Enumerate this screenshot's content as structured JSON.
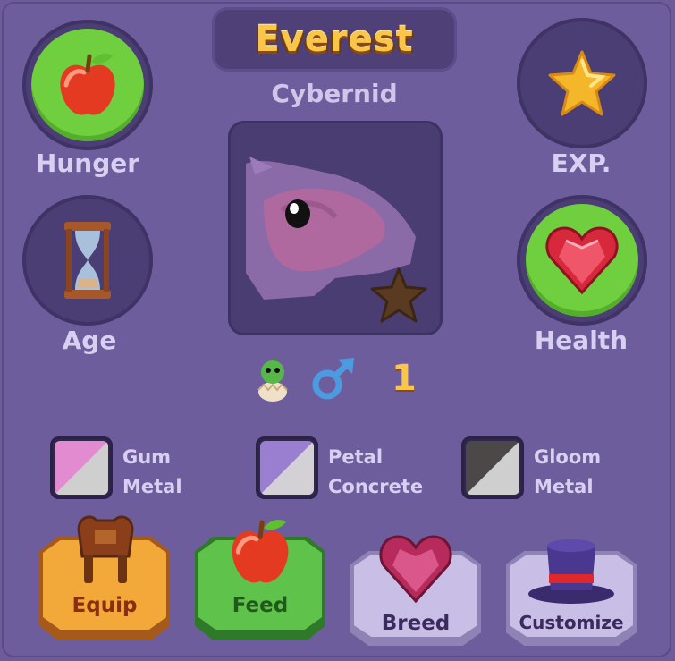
{
  "pet": {
    "name": "Everest",
    "species": "Cybernid",
    "level": "1"
  },
  "stats": {
    "hunger": {
      "label": "Hunger",
      "icon": "apple-icon"
    },
    "age": {
      "label": "Age",
      "icon": "hourglass-icon"
    },
    "exp": {
      "label": "EXP.",
      "icon": "star-icon"
    },
    "health": {
      "label": "Health",
      "icon": "heart-gem-icon"
    }
  },
  "badges": {
    "stage_icon": "hatchling-egg-icon",
    "gender_icon": "male-symbol-icon",
    "rarity_icon": "bronze-star-icon"
  },
  "colors": [
    {
      "line1": "Gum",
      "line2": "Metal",
      "top": "#e38bd0",
      "bottom": "#cfcfcf"
    },
    {
      "line1": "Petal",
      "line2": "Concrete",
      "top": "#9a7fd1",
      "bottom": "#d3d1d6"
    },
    {
      "line1": "Gloom",
      "line2": "Metal",
      "top": "#4b4847",
      "bottom": "#cfcfcf"
    }
  ],
  "actions": {
    "equip": "Equip",
    "feed": "Feed",
    "breed": "Breed",
    "customize": "Customize"
  },
  "theme": {
    "accent_gold": "#f9c64a",
    "panel": "#6e5d9c",
    "green": "#6fcf3e"
  }
}
